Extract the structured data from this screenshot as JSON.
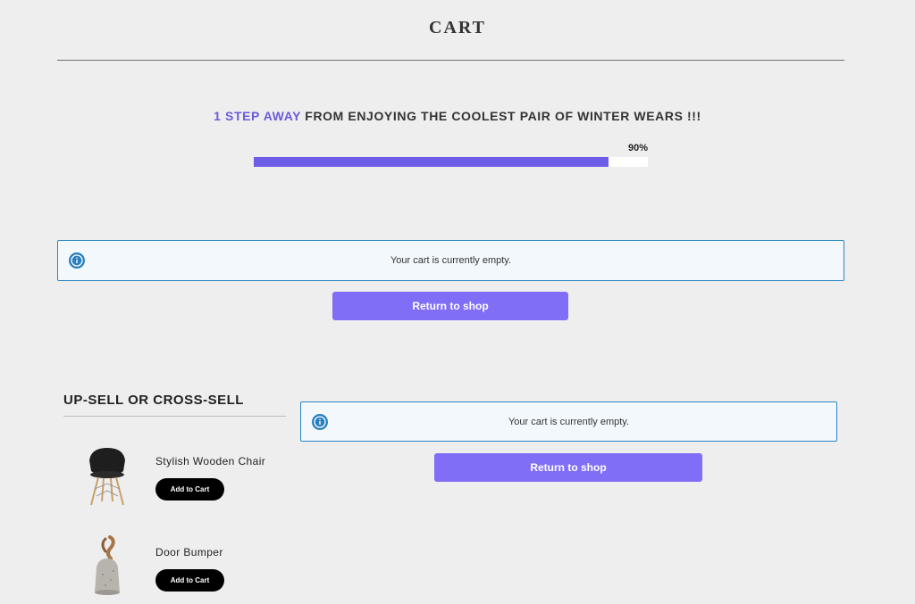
{
  "header": {
    "title": "CART"
  },
  "promo": {
    "accent_text": "1 STEP AWAY",
    "rest_text": " FROM ENJOYING THE COOLEST PAIR OF WINTER WEARS !!!",
    "progress_label": "90%",
    "progress_value": 0.9,
    "accent_color": "#6a5bd6"
  },
  "main_notice": {
    "message": "Your cart is currently empty.",
    "button_label": "Return to shop"
  },
  "upsell": {
    "title": "UP-SELL OR CROSS-SELL",
    "products": [
      {
        "name": "Stylish Wooden Chair",
        "button_label": "Add to Cart"
      },
      {
        "name": "Door Bumper",
        "button_label": "Add to Cart"
      }
    ]
  },
  "side_notice": {
    "message": "Your cart is currently empty.",
    "button_label": "Return to shop"
  },
  "colors": {
    "progress_fill": "#6d5ce6",
    "button": "#806ef6",
    "notice_border": "#2a86c2",
    "info_icon": "#2a7fbf"
  }
}
